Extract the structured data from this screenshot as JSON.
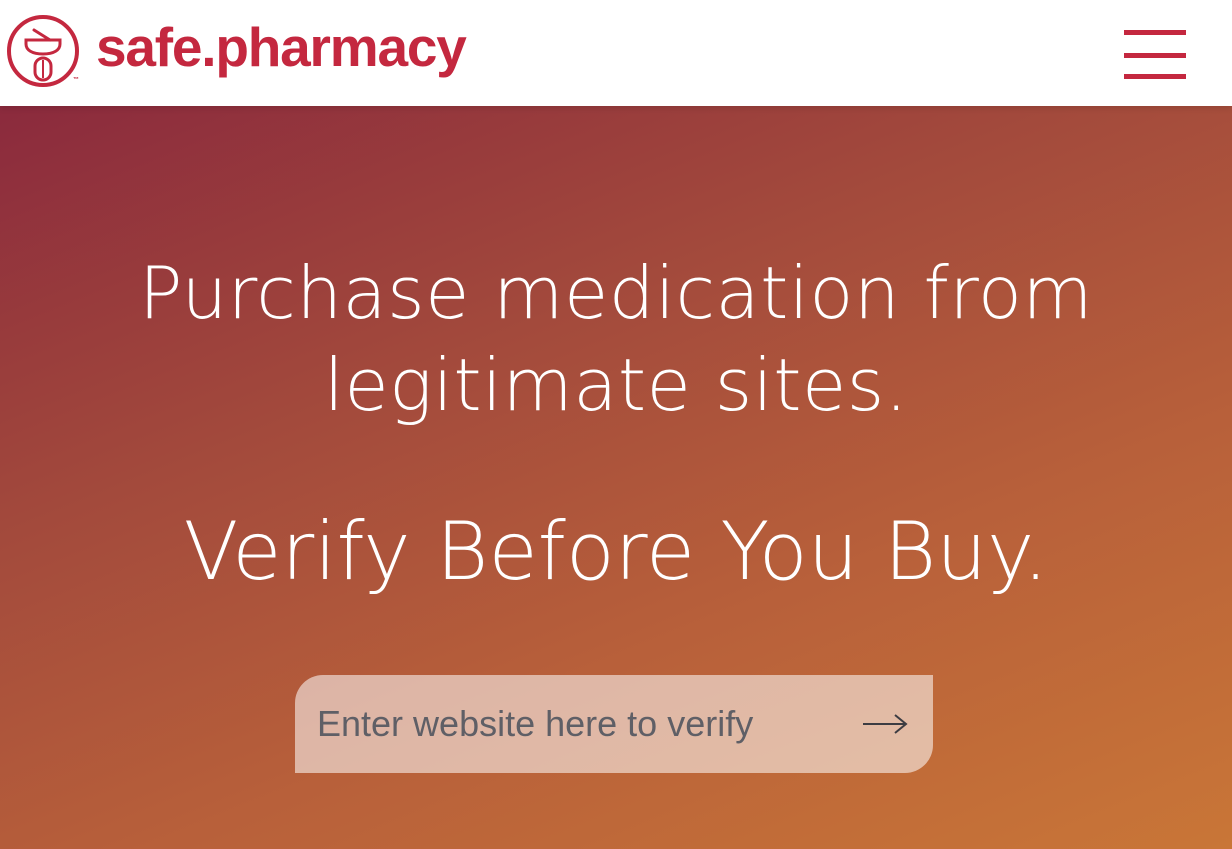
{
  "colors": {
    "brand": "#c4283f",
    "white": "#ffffff",
    "placeholder": "#5f5f66"
  },
  "header": {
    "logo": {
      "icon": "mortar-pestle-logo-icon",
      "text": "safe.pharmacy",
      "trademark": "™"
    },
    "menu_icon": "hamburger-menu-icon"
  },
  "hero": {
    "headline_line1": "Purchase medication from",
    "headline_line2": "legitimate sites.",
    "tagline": "Verify Before You Buy.",
    "search": {
      "placeholder": "Enter website here to verify",
      "value": "",
      "submit_icon": "arrow-right-icon"
    }
  }
}
